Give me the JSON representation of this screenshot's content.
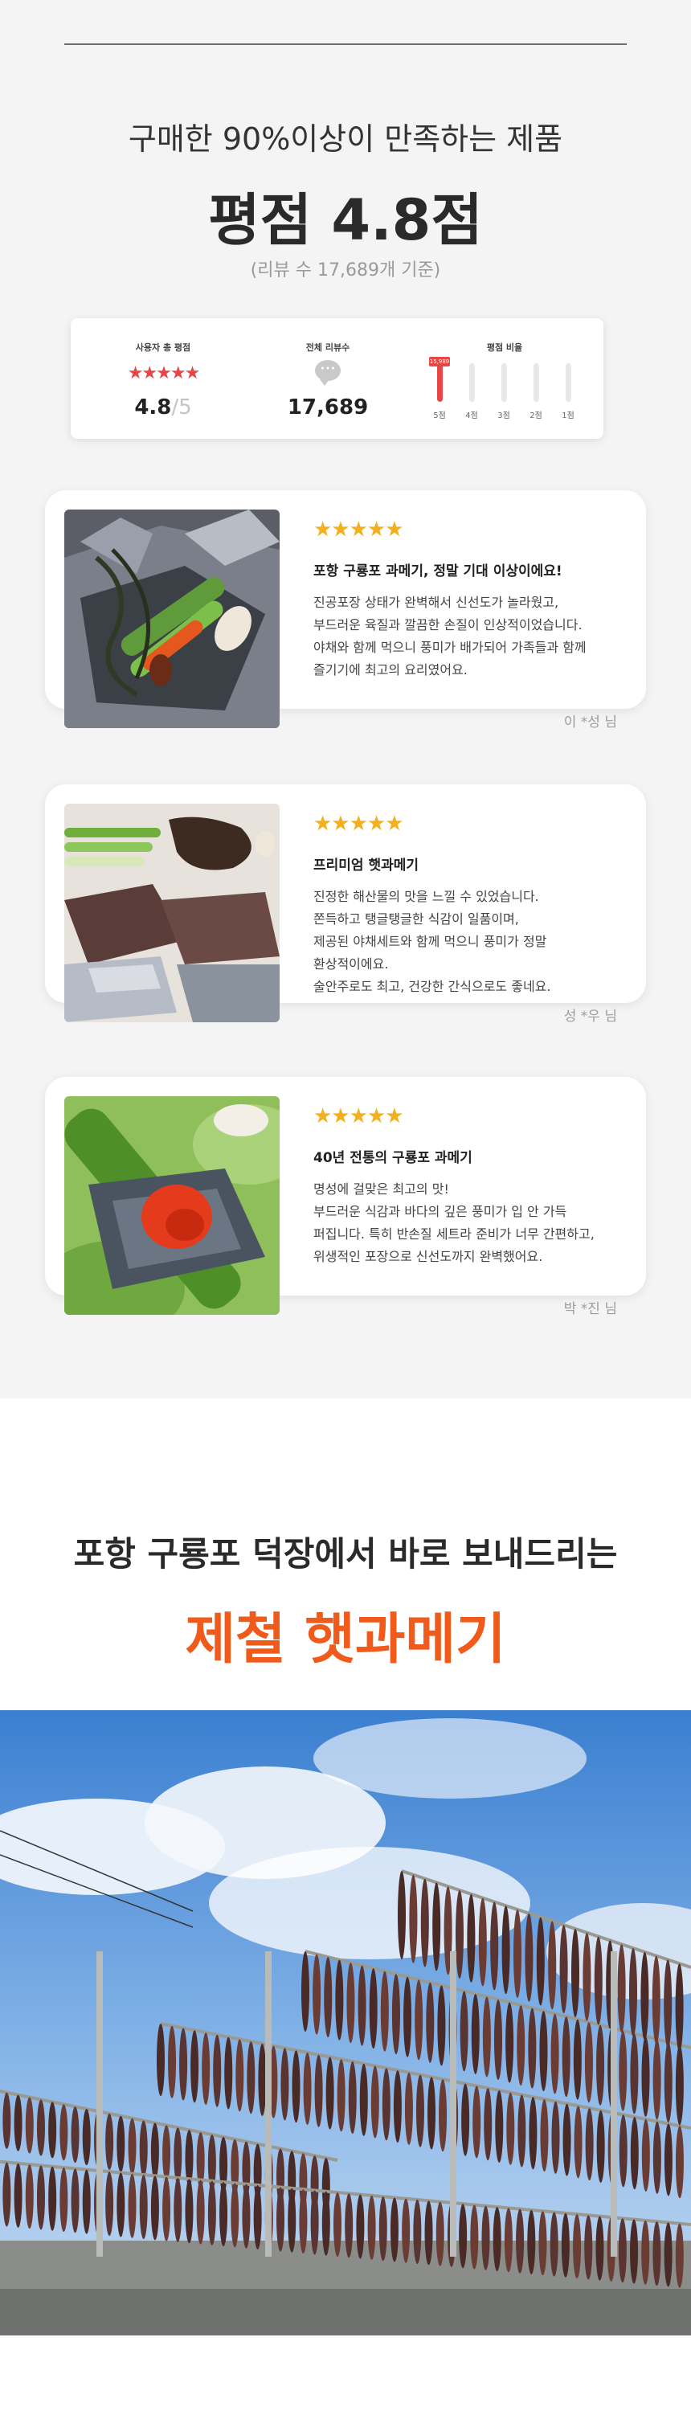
{
  "header": {
    "subtitle": "구매한 90%이상이 만족하는 제품",
    "rating_title": "평점 4.8점",
    "review_note": "(리뷰 수 17,689개 기준)"
  },
  "stats": {
    "avg_label": "사용자 총 평점",
    "avg_stars": "★★★★★",
    "avg_score": "4.8",
    "avg_max": "/5",
    "count_label": "전체 리뷰수",
    "count_value": "17,689",
    "ratio_label": "평점 비율",
    "top_flag": "15,989",
    "distribution": [
      {
        "label": "5점",
        "fraction": 1.0
      },
      {
        "label": "4점",
        "fraction": 0.0
      },
      {
        "label": "3점",
        "fraction": 0.0
      },
      {
        "label": "2점",
        "fraction": 0.0
      },
      {
        "label": "1점",
        "fraction": 0.0
      }
    ],
    "accent_color": "#e74646"
  },
  "reviews": [
    {
      "stars": "★★★★★",
      "title": "포항 구룡포 과메기, 정말 기대 이상이에요!",
      "lines": [
        "진공포장 상태가 완벽해서 신선도가 놀라웠고,",
        "부드러운 육질과 깔끔한 손질이 인상적이었습니다.",
        "야채와 함께 먹으니 풍미가 배가되어 가족들과 함께",
        "즐기기에 최고의 요리였어요."
      ],
      "author": "이 *성 님"
    },
    {
      "stars": "★★★★★",
      "title": "프리미엄 햇과메기",
      "lines": [
        "진정한 해산물의 맛을 느낄 수 있었습니다.",
        "쫀득하고 탱글탱글한 식감이 일품이며,",
        "제공된 야채세트와 함께 먹으니 풍미가 정말",
        "환상적이에요.",
        "술안주로도 최고, 건강한 간식으로도 좋네요."
      ],
      "author": "성 *우 님"
    },
    {
      "stars": "★★★★★",
      "title": "40년 전통의 구룡포 과메기",
      "lines": [
        "명성에 걸맞은 최고의 맛!",
        "부드러운 식감과 바다의 깊은 풍미가 입 안 가득",
        "퍼집니다. 특히 반손질 세트라 준비가 너무 간편하고,",
        "위생적인 포장으로 신선도까지 완벽했어요."
      ],
      "author": "박 *진 님"
    }
  ],
  "section2": {
    "line1": "포항 구룡포 덕장에서 바로 보내드리는",
    "line2": "제철 햇과메기",
    "accent_color": "#f05a1a"
  }
}
